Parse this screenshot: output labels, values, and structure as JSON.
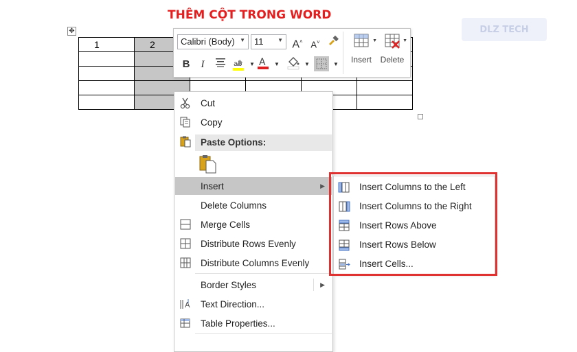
{
  "title": "THÊM CỘT TRONG WORD",
  "watermark": "DLZ TECH",
  "table": {
    "rows": [
      [
        "1",
        "2",
        "",
        "",
        "",
        "",
        ""
      ],
      [
        "",
        "",
        "",
        "",
        "",
        "",
        ""
      ],
      [
        "",
        "",
        "",
        "",
        "",
        "",
        ""
      ],
      [
        "",
        "",
        "",
        "",
        "",
        "",
        ""
      ],
      [
        "",
        "",
        "",
        "",
        "",
        "",
        ""
      ]
    ]
  },
  "mini_toolbar": {
    "font": "Calibri (Body)",
    "size": "11",
    "insert_label": "Insert",
    "delete_label": "Delete"
  },
  "context_menu": {
    "cut": "Cut",
    "copy": "Copy",
    "paste_options": "Paste Options:",
    "insert": "Insert",
    "delete_columns": "Delete Columns",
    "merge_cells": "Merge Cells",
    "distribute_rows": "Distribute Rows Evenly",
    "distribute_columns": "Distribute Columns Evenly",
    "border_styles": "Border Styles",
    "text_direction": "Text Direction...",
    "table_properties": "Table Properties..."
  },
  "insert_submenu": {
    "cols_left": "Insert Columns to the Left",
    "cols_right": "Insert Columns to the Right",
    "rows_above": "Insert Rows Above",
    "rows_below": "Insert Rows Below",
    "cells": "Insert Cells..."
  },
  "colors": {
    "title": "#e41e1e",
    "highlight_border": "#e03131",
    "selection": "#c6c6c6"
  }
}
